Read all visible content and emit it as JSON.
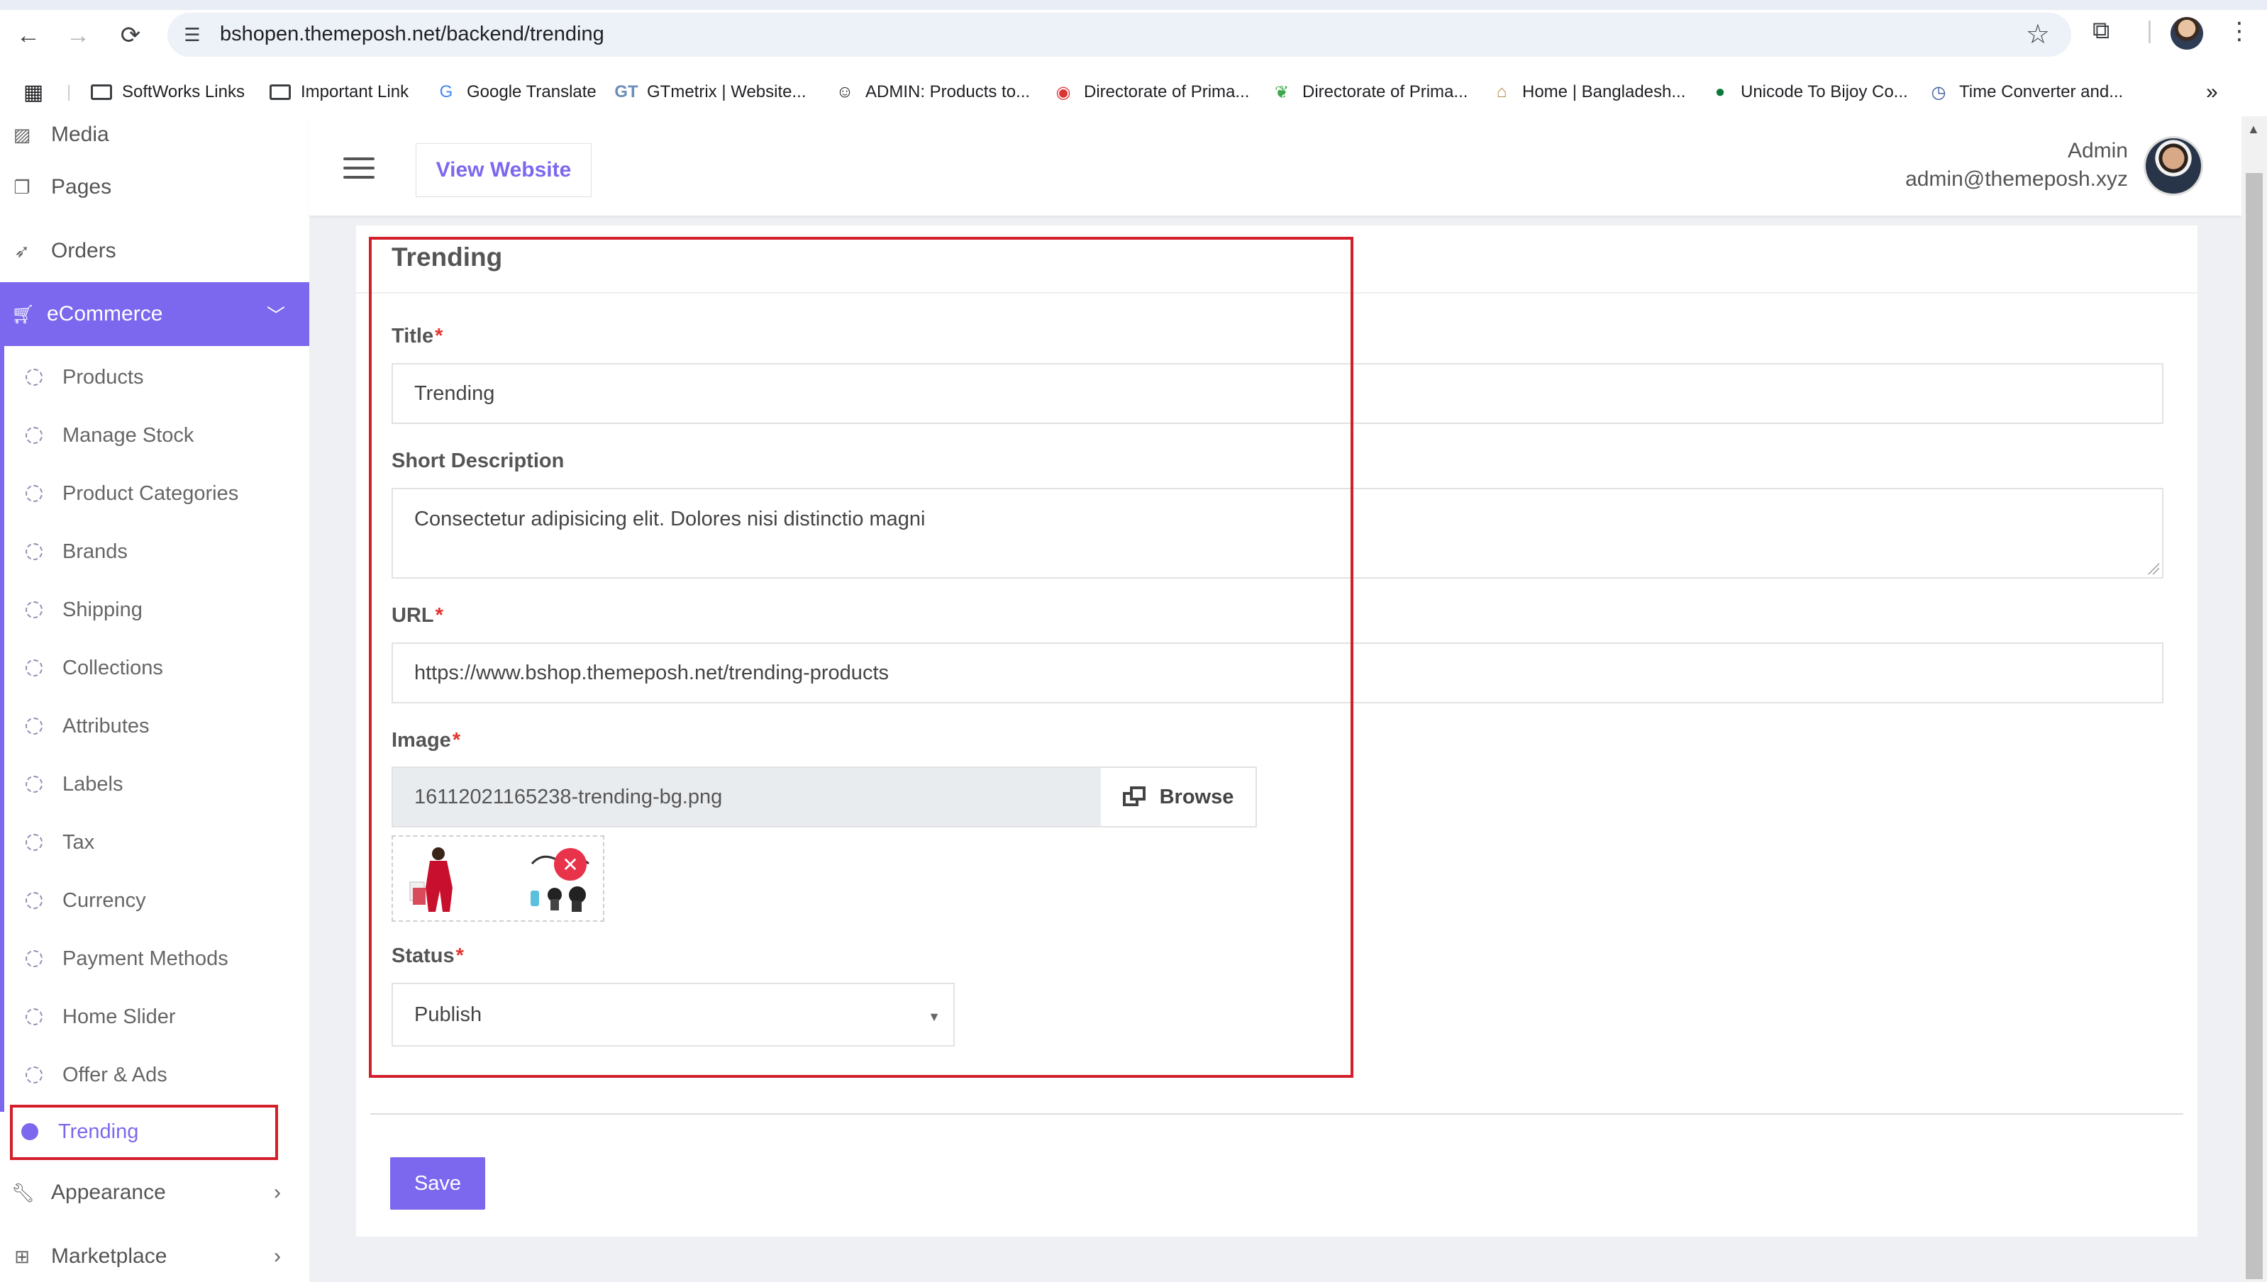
{
  "browser": {
    "url": "bshopen.themeposh.net/backend/trending",
    "bookmarks": [
      {
        "label": "SoftWorks Links",
        "icon": "folder-icon"
      },
      {
        "label": "Important Link",
        "icon": "folder-icon"
      },
      {
        "label": "Google Translate",
        "icon": "google-translate-icon"
      },
      {
        "label": "GTmetrix | Website...",
        "icon": "gtmetrix-icon"
      },
      {
        "label": "ADMIN: Products to...",
        "icon": "smiley-icon"
      },
      {
        "label": "Directorate of Prima...",
        "icon": "emblem-icon"
      },
      {
        "label": "Directorate of Prima...",
        "icon": "leaf-icon"
      },
      {
        "label": "Home | Bangladesh...",
        "icon": "house-icon"
      },
      {
        "label": "Unicode To Bijoy Co...",
        "icon": "flag-icon"
      },
      {
        "label": "Time Converter and...",
        "icon": "clock-icon"
      }
    ]
  },
  "sidebar": {
    "top_items": [
      {
        "label": "Media",
        "icon": "image-icon"
      },
      {
        "label": "Pages",
        "icon": "pages-icon"
      },
      {
        "label": "Orders",
        "icon": "rocket-icon"
      }
    ],
    "ecommerce": {
      "label": "eCommerce",
      "icon": "cart-icon"
    },
    "sub_items": [
      "Products",
      "Manage Stock",
      "Product Categories",
      "Brands",
      "Shipping",
      "Collections",
      "Attributes",
      "Labels",
      "Tax",
      "Currency",
      "Payment Methods",
      "Home Slider",
      "Offer & Ads",
      "Trending"
    ],
    "bottom_items": [
      {
        "label": "Appearance",
        "icon": "wrench-icon"
      },
      {
        "label": "Marketplace",
        "icon": "sitemap-icon"
      }
    ]
  },
  "topbar": {
    "view_website": "View Website",
    "user_name": "Admin",
    "user_email": "admin@themeposh.xyz"
  },
  "form": {
    "card_title": "Trending",
    "title_label": "Title",
    "title_value": "Trending",
    "short_desc_label": "Short Description",
    "short_desc_value": "Consectetur adipisicing elit. Dolores nisi distinctio magni",
    "url_label": "URL",
    "url_value": "https://www.bshop.themeposh.net/trending-products",
    "image_label": "Image",
    "image_value": "16112021165238-trending-bg.png",
    "browse_label": "Browse",
    "status_label": "Status",
    "status_value": "Publish",
    "required_mark": "*",
    "save_label": "Save"
  },
  "colors": {
    "accent": "#7b68ee",
    "highlight": "#d31f2a",
    "remove": "#e8334a"
  }
}
